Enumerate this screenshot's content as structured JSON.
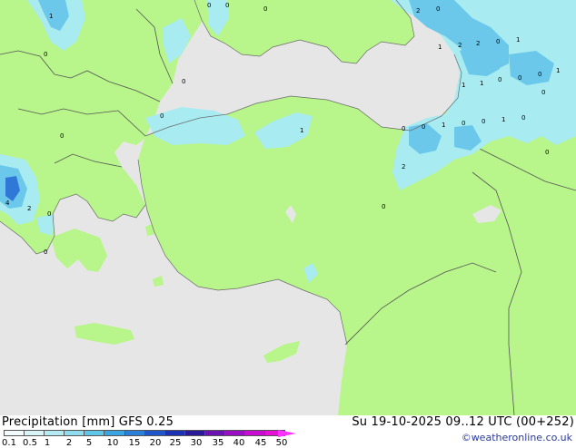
{
  "map": {
    "colors": {
      "sea": "#e6e6e6",
      "land": "#b8f58a",
      "precip_light": "#a8ecf2",
      "precip_mid": "#6cc8ea",
      "precip_heavy": "#2f78d8"
    },
    "value_labels": [
      {
        "id": "v1",
        "text": "1"
      },
      {
        "id": "v2",
        "text": "0"
      },
      {
        "id": "v3",
        "text": "0"
      },
      {
        "id": "v4",
        "text": "0"
      },
      {
        "id": "v5",
        "text": "0"
      },
      {
        "id": "v6",
        "text": "0"
      },
      {
        "id": "v7",
        "text": "0"
      },
      {
        "id": "v8",
        "text": "0"
      },
      {
        "id": "v9",
        "text": "4"
      },
      {
        "id": "v10",
        "text": "2"
      },
      {
        "id": "v11",
        "text": "0"
      },
      {
        "id": "v12",
        "text": "0"
      },
      {
        "id": "v13",
        "text": "1"
      },
      {
        "id": "v14",
        "text": "2"
      },
      {
        "id": "v15",
        "text": "0"
      },
      {
        "id": "v16",
        "text": "1"
      },
      {
        "id": "v17",
        "text": "2"
      },
      {
        "id": "v18",
        "text": "2"
      },
      {
        "id": "v19",
        "text": "0"
      },
      {
        "id": "v20",
        "text": "1"
      },
      {
        "id": "v21",
        "text": "1"
      },
      {
        "id": "v22",
        "text": "1"
      },
      {
        "id": "v23",
        "text": "0"
      },
      {
        "id": "v24",
        "text": "0"
      },
      {
        "id": "v25",
        "text": "0"
      },
      {
        "id": "v26",
        "text": "1"
      },
      {
        "id": "v27",
        "text": "0"
      },
      {
        "id": "v28",
        "text": "0"
      },
      {
        "id": "v29",
        "text": "1"
      },
      {
        "id": "v30",
        "text": "0"
      },
      {
        "id": "v31",
        "text": "0"
      },
      {
        "id": "v32",
        "text": "1"
      },
      {
        "id": "v33",
        "text": "0"
      },
      {
        "id": "v34",
        "text": "0"
      },
      {
        "id": "v35",
        "text": "2"
      },
      {
        "id": "v36",
        "text": "0"
      },
      {
        "id": "v37",
        "text": "0"
      }
    ]
  },
  "footer": {
    "title": "Precipitation [mm]  GFS 0.25",
    "timestamp": "Su 19-10-2025 09..12 UTC (00+252)",
    "credit": "©weatheronline.co.uk"
  },
  "legend": {
    "ticks": [
      "0.1",
      "0.5",
      "1",
      "2",
      "5",
      "10",
      "15",
      "20",
      "25",
      "30",
      "35",
      "40",
      "45",
      "50"
    ],
    "colors": [
      "#f2fbfc",
      "#d8f4f7",
      "#b4eaf2",
      "#8fdcef",
      "#5fc6ea",
      "#3aa4e2",
      "#2a7fd8",
      "#1e56c9",
      "#1c32b4",
      "#2a1a9a",
      "#6a12b2",
      "#9a0ec4",
      "#c80cd2",
      "#e810d6"
    ]
  }
}
